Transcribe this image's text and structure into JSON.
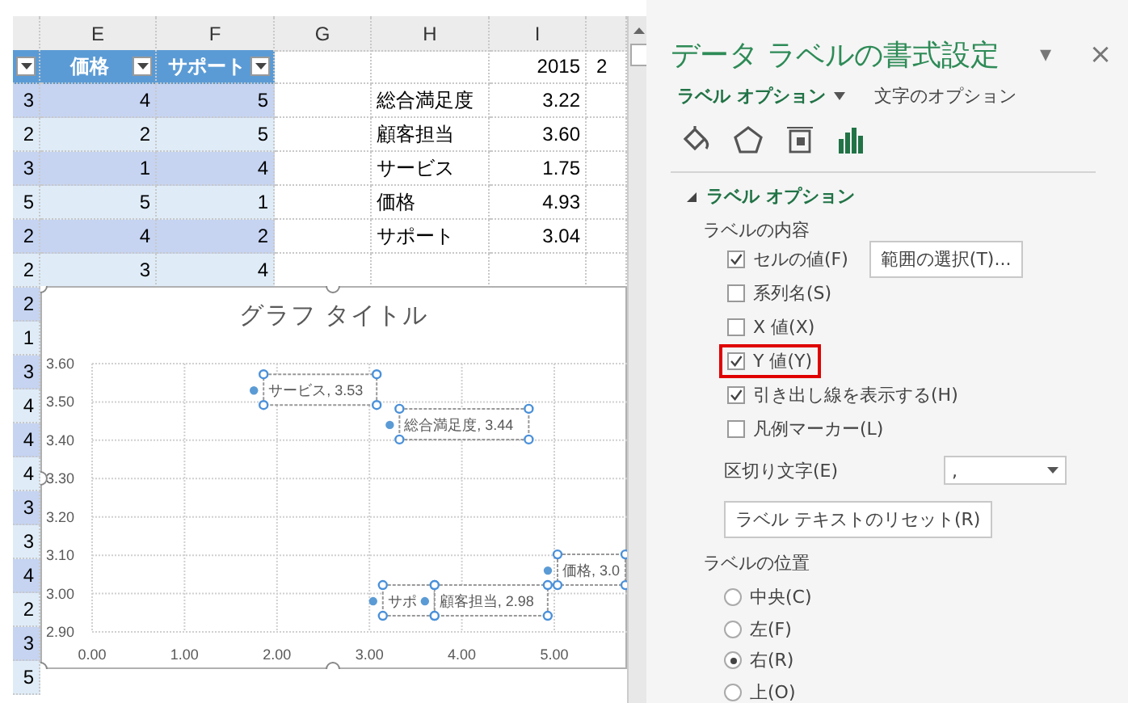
{
  "sheet": {
    "columns": [
      "E",
      "F",
      "G",
      "H",
      "I"
    ],
    "table_header": {
      "e": "価格",
      "f": "サポート",
      "i": "2015",
      "j": "2"
    },
    "rows": [
      {
        "d": "3",
        "e": "4",
        "f": "5",
        "h": "総合満足度",
        "i": "3.22"
      },
      {
        "d": "2",
        "e": "2",
        "f": "5",
        "h": "顧客担当",
        "i": "3.60"
      },
      {
        "d": "3",
        "e": "1",
        "f": "4",
        "h": "サービス",
        "i": "1.75"
      },
      {
        "d": "5",
        "e": "5",
        "f": "1",
        "h": "価格",
        "i": "4.93"
      },
      {
        "d": "2",
        "e": "4",
        "f": "2",
        "h": "サポート",
        "i": "3.04"
      },
      {
        "d": "2",
        "e": "3",
        "f": "4"
      },
      {
        "d": "2"
      },
      {
        "d": "1"
      },
      {
        "d": "3"
      },
      {
        "d": "4"
      },
      {
        "d": "4"
      },
      {
        "d": "4"
      },
      {
        "d": "3"
      },
      {
        "d": "3"
      },
      {
        "d": "4"
      },
      {
        "d": "2"
      },
      {
        "d": "3"
      },
      {
        "d": "5"
      }
    ]
  },
  "chart": {
    "title": "グラフ タイトル",
    "chart_data": {
      "type": "scatter",
      "x": [
        1.75,
        3.22,
        4.93,
        3.04,
        3.6
      ],
      "series": [
        {
          "color": "#5b9bd5",
          "values": [
            3.53,
            3.44,
            3.06,
            2.98,
            2.98
          ]
        }
      ],
      "value_labels": [
        "サービス, 3.53",
        "総合満足度, 3.44",
        "価格, 3.0",
        "サポ",
        "顧客担当, 2.98"
      ],
      "xlim": [
        0,
        6
      ],
      "ylim": [
        2.9,
        3.6
      ],
      "grid": true,
      "xticks": [
        {
          "value": 0,
          "label": "0.00"
        },
        {
          "value": 1,
          "label": "1.00"
        },
        {
          "value": 2,
          "label": "2.00"
        },
        {
          "value": 3,
          "label": "3.00"
        },
        {
          "value": 4,
          "label": "4.00"
        },
        {
          "value": 5,
          "label": "5.00"
        }
      ],
      "yticks": [
        {
          "value": 2.9,
          "label": "2.90"
        },
        {
          "value": 3.0,
          "label": "3.00"
        },
        {
          "value": 3.1,
          "label": "3.10"
        },
        {
          "value": 3.2,
          "label": "3.20"
        },
        {
          "value": 3.3,
          "label": "3.30"
        },
        {
          "value": 3.4,
          "label": "3.40"
        },
        {
          "value": 3.5,
          "label": "3.50"
        },
        {
          "value": 3.6,
          "label": "3.60"
        }
      ]
    }
  },
  "panel": {
    "title": "データ ラベルの書式設定",
    "menu_glyph": "▾",
    "close_glyph": "×",
    "subtabs": [
      {
        "label": "ラベル オプション",
        "selected": true
      },
      {
        "label": "文字のオプション",
        "selected": false
      }
    ],
    "icon_tabs": [
      {
        "kind": "fill",
        "selected": false
      },
      {
        "kind": "effects",
        "selected": false
      },
      {
        "kind": "size",
        "selected": false
      },
      {
        "kind": "options",
        "selected": true
      }
    ],
    "section": {
      "title": "ラベル オプション",
      "expanded": true
    },
    "contents_label": "ラベルの内容",
    "checkboxes": [
      {
        "label": "セルの値(F)",
        "checked": true,
        "highlighted": false,
        "button": "範囲の選択(T)..."
      },
      {
        "label": "系列名(S)",
        "checked": false,
        "highlighted": false
      },
      {
        "label": "X 値(X)",
        "checked": false,
        "highlighted": false
      },
      {
        "label": "Y 値(Y)",
        "checked": true,
        "highlighted": true
      },
      {
        "label": "引き出し線を表示する(H)",
        "checked": true,
        "highlighted": false
      },
      {
        "label": "凡例マーカー(L)",
        "checked": false,
        "highlighted": false
      }
    ],
    "separator": {
      "label": "区切り文字(E)",
      "value": ","
    },
    "reset_button": "ラベル テキストのリセット(R)",
    "position_label": "ラベルの位置",
    "radios": [
      {
        "label": "中央(C)",
        "selected": false
      },
      {
        "label": "左(F)",
        "selected": false
      },
      {
        "label": "右(R)",
        "selected": true
      },
      {
        "label": "上(O)",
        "selected": false
      }
    ]
  }
}
